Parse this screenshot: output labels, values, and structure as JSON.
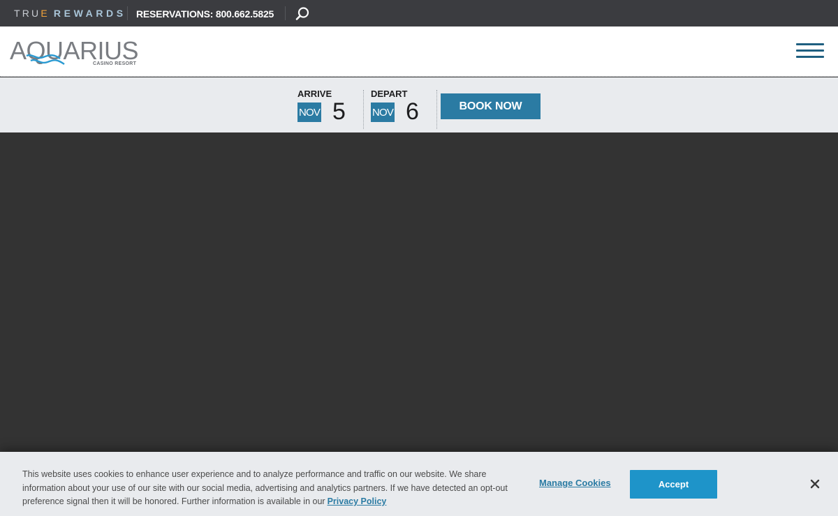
{
  "topbar": {
    "rewards_logo": {
      "part1": "TRU",
      "accent": "E",
      "part2": "REWARDS"
    },
    "reservations": "RESERVATIONS: 800.662.5825",
    "search_icon": "search-icon"
  },
  "header": {
    "brand_name": "AQUARIUS",
    "brand_sub": "CASINO RESORT",
    "menu_icon": "hamburger-icon"
  },
  "booking": {
    "arrive": {
      "label": "ARRIVE",
      "month": "NOV",
      "day": "5"
    },
    "depart": {
      "label": "DEPART",
      "month": "NOV",
      "day": "6"
    },
    "book_now": "BOOK NOW"
  },
  "cookie_banner": {
    "text": "This website uses cookies to enhance user experience and to analyze performance and traffic on our website. We share information about your use of our site with our social media, advertising and analytics partners. If we have detected an opt-out preference signal then it will be honored. Further information is available in our",
    "privacy_link": "Privacy Policy",
    "manage_cookies": "Manage Cookies",
    "accept": "Accept",
    "close_icon": "close-icon"
  },
  "colors": {
    "topbar_bg": "#3b3c40",
    "accent_blue": "#2b7ba3",
    "accept_blue": "#1e94c9",
    "booking_bg": "#e9ebee",
    "hero_bg": "#333333"
  }
}
